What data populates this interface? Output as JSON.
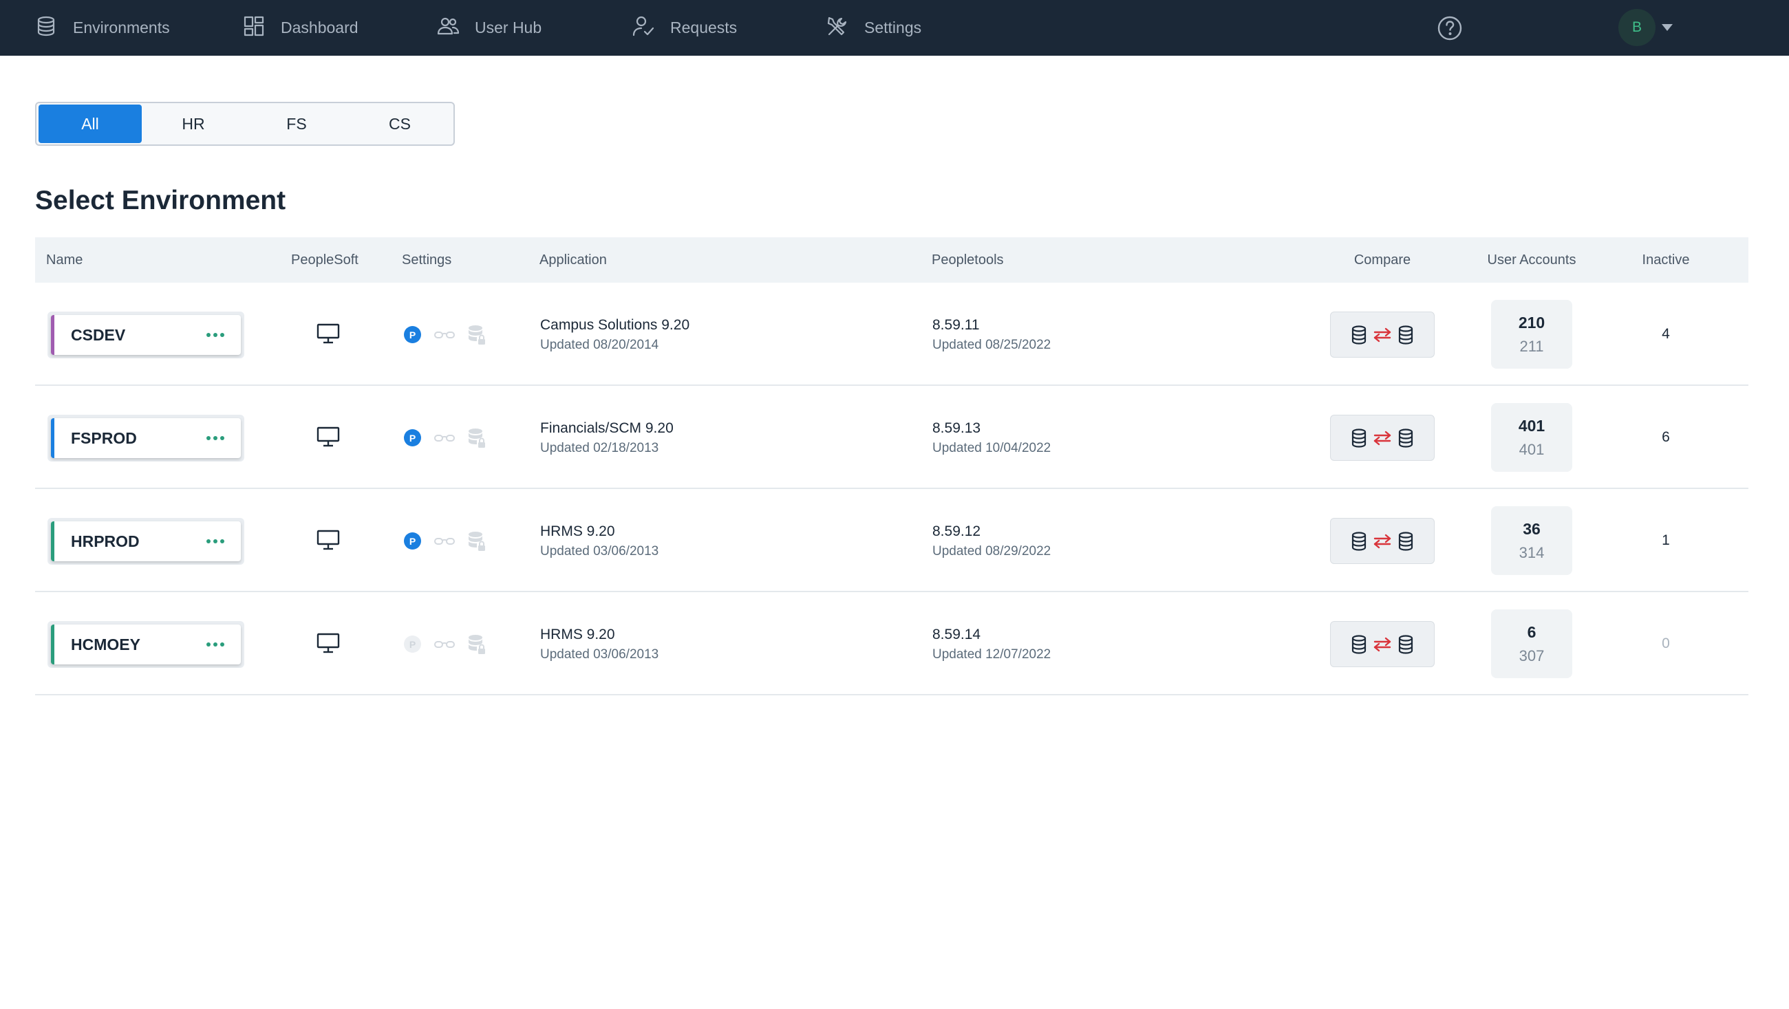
{
  "nav": {
    "items": [
      {
        "label": "Environments",
        "icon": "database-icon"
      },
      {
        "label": "Dashboard",
        "icon": "dashboard-icon"
      },
      {
        "label": "User Hub",
        "icon": "users-icon"
      },
      {
        "label": "Requests",
        "icon": "user-check-icon"
      },
      {
        "label": "Settings",
        "icon": "tools-icon"
      }
    ],
    "help_icon": "help-circle-icon",
    "avatar_initial": "B"
  },
  "filters": {
    "tabs": [
      "All",
      "HR",
      "FS",
      "CS"
    ],
    "active": "All"
  },
  "page_title": "Select Environment",
  "table": {
    "headers": {
      "name": "Name",
      "peoplesoft": "PeopleSoft",
      "settings": "Settings",
      "application": "Application",
      "peopletools": "Peopletools",
      "compare": "Compare",
      "user_accounts": "User Accounts",
      "inactive": "Inactive"
    },
    "rows": [
      {
        "name": "CSDEV",
        "accent_color": "#a05cb0",
        "settings_p_enabled": true,
        "application": "Campus Solutions 9.20",
        "application_updated": "Updated 08/20/2014",
        "peopletools": "8.59.11",
        "peopletools_updated": "Updated 08/25/2022",
        "user_accounts_top": "210",
        "user_accounts_bottom": "211",
        "inactive": "4"
      },
      {
        "name": "FSPROD",
        "accent_color": "#1a7fe0",
        "settings_p_enabled": true,
        "application": "Financials/SCM 9.20",
        "application_updated": "Updated 02/18/2013",
        "peopletools": "8.59.13",
        "peopletools_updated": "Updated 10/04/2022",
        "user_accounts_top": "401",
        "user_accounts_bottom": "401",
        "inactive": "6"
      },
      {
        "name": "HRPROD",
        "accent_color": "#2a9d7c",
        "settings_p_enabled": true,
        "application": "HRMS 9.20",
        "application_updated": "Updated 03/06/2013",
        "peopletools": "8.59.12",
        "peopletools_updated": "Updated 08/29/2022",
        "user_accounts_top": "36",
        "user_accounts_bottom": "314",
        "inactive": "1"
      },
      {
        "name": "HCMOEY",
        "accent_color": "#2a9d7c",
        "settings_p_enabled": false,
        "application": "HRMS 9.20",
        "application_updated": "Updated 03/06/2013",
        "peopletools": "8.59.14",
        "peopletools_updated": "Updated 12/07/2022",
        "user_accounts_top": "6",
        "user_accounts_bottom": "307",
        "inactive": "0"
      }
    ]
  },
  "icons": {
    "settings_p_label": "P",
    "peoplesoft": "monitor-icon",
    "compare": "database-compare-icon"
  }
}
